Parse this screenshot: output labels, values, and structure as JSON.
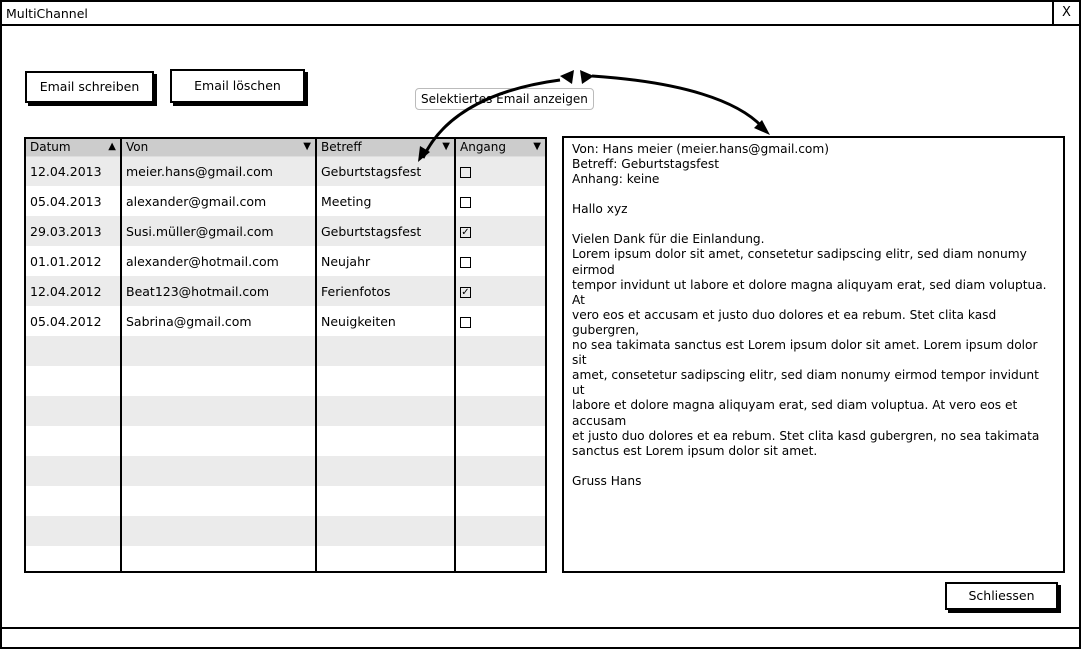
{
  "window": {
    "title": "MultiChannel",
    "close_label": "X"
  },
  "toolbar": {
    "write_label": "Email schreiben",
    "delete_label": "Email löschen"
  },
  "annotation": {
    "callout": "Selektiertes Email anzeigen"
  },
  "table": {
    "headers": [
      {
        "label": "Datum",
        "sort_icon": "▲"
      },
      {
        "label": "Von",
        "sort_icon": "▼"
      },
      {
        "label": "Betreff",
        "sort_icon": "▼"
      },
      {
        "label": "Angang",
        "sort_icon": "▼"
      }
    ],
    "rows": [
      {
        "datum": "12.04.2013",
        "von": "meier.hans@gmail.com",
        "betreff": "Geburtstagsfest",
        "anhang": false
      },
      {
        "datum": "05.04.2013",
        "von": "alexander@gmail.com",
        "betreff": "Meeting",
        "anhang": false
      },
      {
        "datum": "29.03.2013",
        "von": "Susi.müller@gmail.com",
        "betreff": "Geburtstagsfest",
        "anhang": true
      },
      {
        "datum": "01.01.2012",
        "von": "alexander@hotmail.com",
        "betreff": "Neujahr",
        "anhang": false
      },
      {
        "datum": "12.04.2012",
        "von": "Beat123@hotmail.com",
        "betreff": "Ferienfotos",
        "anhang": true
      },
      {
        "datum": "05.04.2012",
        "von": "Sabrina@gmail.com",
        "betreff": "Neuigkeiten",
        "anhang": false
      }
    ],
    "empty_rows": 8
  },
  "detail": {
    "von": "Von: Hans meier (meier.hans@gmail.com)",
    "betreff": "Betreff: Geburtstagsfest",
    "anhang": "Anhang: keine",
    "greeting": "Hallo xyz",
    "body_lines": [
      "Vielen Dank für die Einlandung.",
      "Lorem ipsum dolor sit amet, consetetur sadipscing elitr, sed diam nonumy eirmod",
      "tempor invidunt ut labore et dolore magna aliquyam erat, sed diam voluptua. At",
      "vero eos et accusam et justo duo dolores et ea rebum. Stet clita kasd gubergren,",
      "no sea takimata sanctus est Lorem ipsum dolor sit amet. Lorem ipsum dolor sit",
      "amet, consetetur sadipscing elitr, sed diam nonumy eirmod tempor invidunt ut",
      "labore et dolore magna aliquyam erat, sed diam voluptua. At vero eos et accusam",
      "et justo duo dolores et ea rebum. Stet clita kasd gubergren, no sea takimata",
      "sanctus est Lorem ipsum dolor sit amet."
    ],
    "signature": "Gruss Hans"
  },
  "footer": {
    "close_label": "Schliessen"
  }
}
